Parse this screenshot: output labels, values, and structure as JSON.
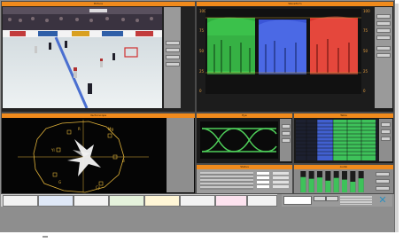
{
  "panels": {
    "picture": {
      "title": "Picture"
    },
    "waveform": {
      "title": "Waveform"
    },
    "vectorscope": {
      "title": "Vectorscope"
    },
    "eye": {
      "title": "Eye"
    },
    "status": {
      "title": "Status"
    },
    "table": {
      "title": "Table"
    },
    "audio": {
      "title": "Audio"
    }
  },
  "waveform": {
    "scale_left": [
      "100",
      "75",
      "50",
      "25",
      "0"
    ],
    "scale_right": [
      "100",
      "75",
      "50",
      "25",
      "0"
    ],
    "channels": [
      {
        "name": "G",
        "color": "#35c84a"
      },
      {
        "name": "B",
        "color": "#3f5fe8"
      },
      {
        "name": "R",
        "color": "#e83a2a"
      }
    ]
  },
  "vectorscope": {
    "targets": [
      "R",
      "Mg",
      "B",
      "Cy",
      "G",
      "Yl"
    ]
  },
  "colors": {
    "title_bar": "#f08a1c",
    "panel_bg": "#1a1a1a",
    "screen_bg": "#8e8e8e",
    "scope_gold": "#e0b23a",
    "eye_green": "#4fd05a",
    "table_green": "#3ec25a",
    "table_blue": "#4160d0"
  },
  "audio": {
    "levels": [
      0.72,
      0.64,
      0.7,
      0.55,
      0.68,
      0.6,
      0.5,
      0.66
    ]
  }
}
